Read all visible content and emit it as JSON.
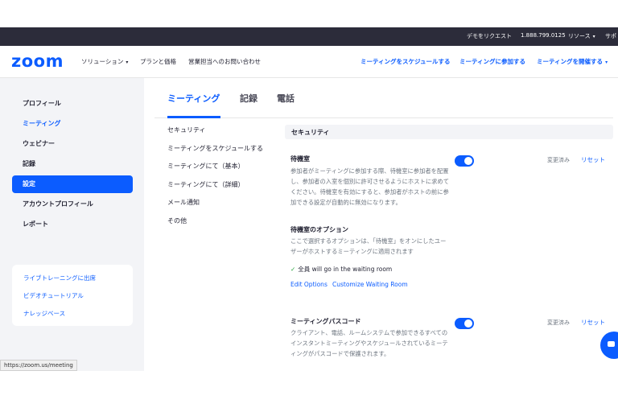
{
  "topbar": {
    "demo": "デモをリクエスト",
    "phone": "1.888.799.0125",
    "resources": "リソース",
    "support": "サポ"
  },
  "header": {
    "logo": "zoom",
    "nav": [
      "ソリューション",
      "プランと価格",
      "営業担当へのお問い合わせ"
    ],
    "right_nav": [
      "ミーティングをスケジュールする",
      "ミーティングに参加する",
      "ミーティングを開催する"
    ]
  },
  "sidebar": {
    "items": [
      "プロフィール",
      "ミーティング",
      "ウェビナー",
      "記録",
      "設定",
      "アカウントプロフィール",
      "レポート"
    ],
    "active": "設定",
    "help": [
      "ライブトレーニングに出席",
      "ビデオチュートリアル",
      "ナレッジベース"
    ]
  },
  "tabs": [
    "ミーティング",
    "記録",
    "電話"
  ],
  "submenu": [
    "セキュリティ",
    "ミーティングをスケジュールする",
    "ミーティングにて（基本）",
    "ミーティングにて（詳細）",
    "メール通知",
    "その他"
  ],
  "section": {
    "title": "セキュリティ",
    "waiting_room": {
      "title": "待機室",
      "description": "参加者がミーティングに参加する際、待機室に参加者を配置し、参加者の入室を個別に許可させるようにホストに求めてください。待機室を有効にすると、参加者がホストの前に参加できる設定が自動的に無効になります。",
      "changed": "変更済み",
      "reset": "リセット",
      "enabled": true
    },
    "waiting_room_options": {
      "title": "待機室のオプション",
      "description": "ここで選択するオプションは、「待機室」をオンにしたユーザーがホストするミーティングに適用されます",
      "check_prefix": "全員",
      "check_text": " will go in the waiting room",
      "edit_options": "Edit Options",
      "customize": "Customize Waiting Room"
    },
    "passcode": {
      "title": "ミーティングパスコード",
      "description": "クライアント、電話、ルームシステムで参加できるすべてのインスタントミーティングやスケジュールされているミーティングがパスコードで保護されます。",
      "changed": "変更済み",
      "reset": "リセット",
      "enabled": true
    }
  },
  "status_url": "https://zoom.us/meeting",
  "colors": {
    "accent": "#0b5cff",
    "topbar": "#2c2c3a",
    "sidebar_bg": "#f3f4f7"
  }
}
